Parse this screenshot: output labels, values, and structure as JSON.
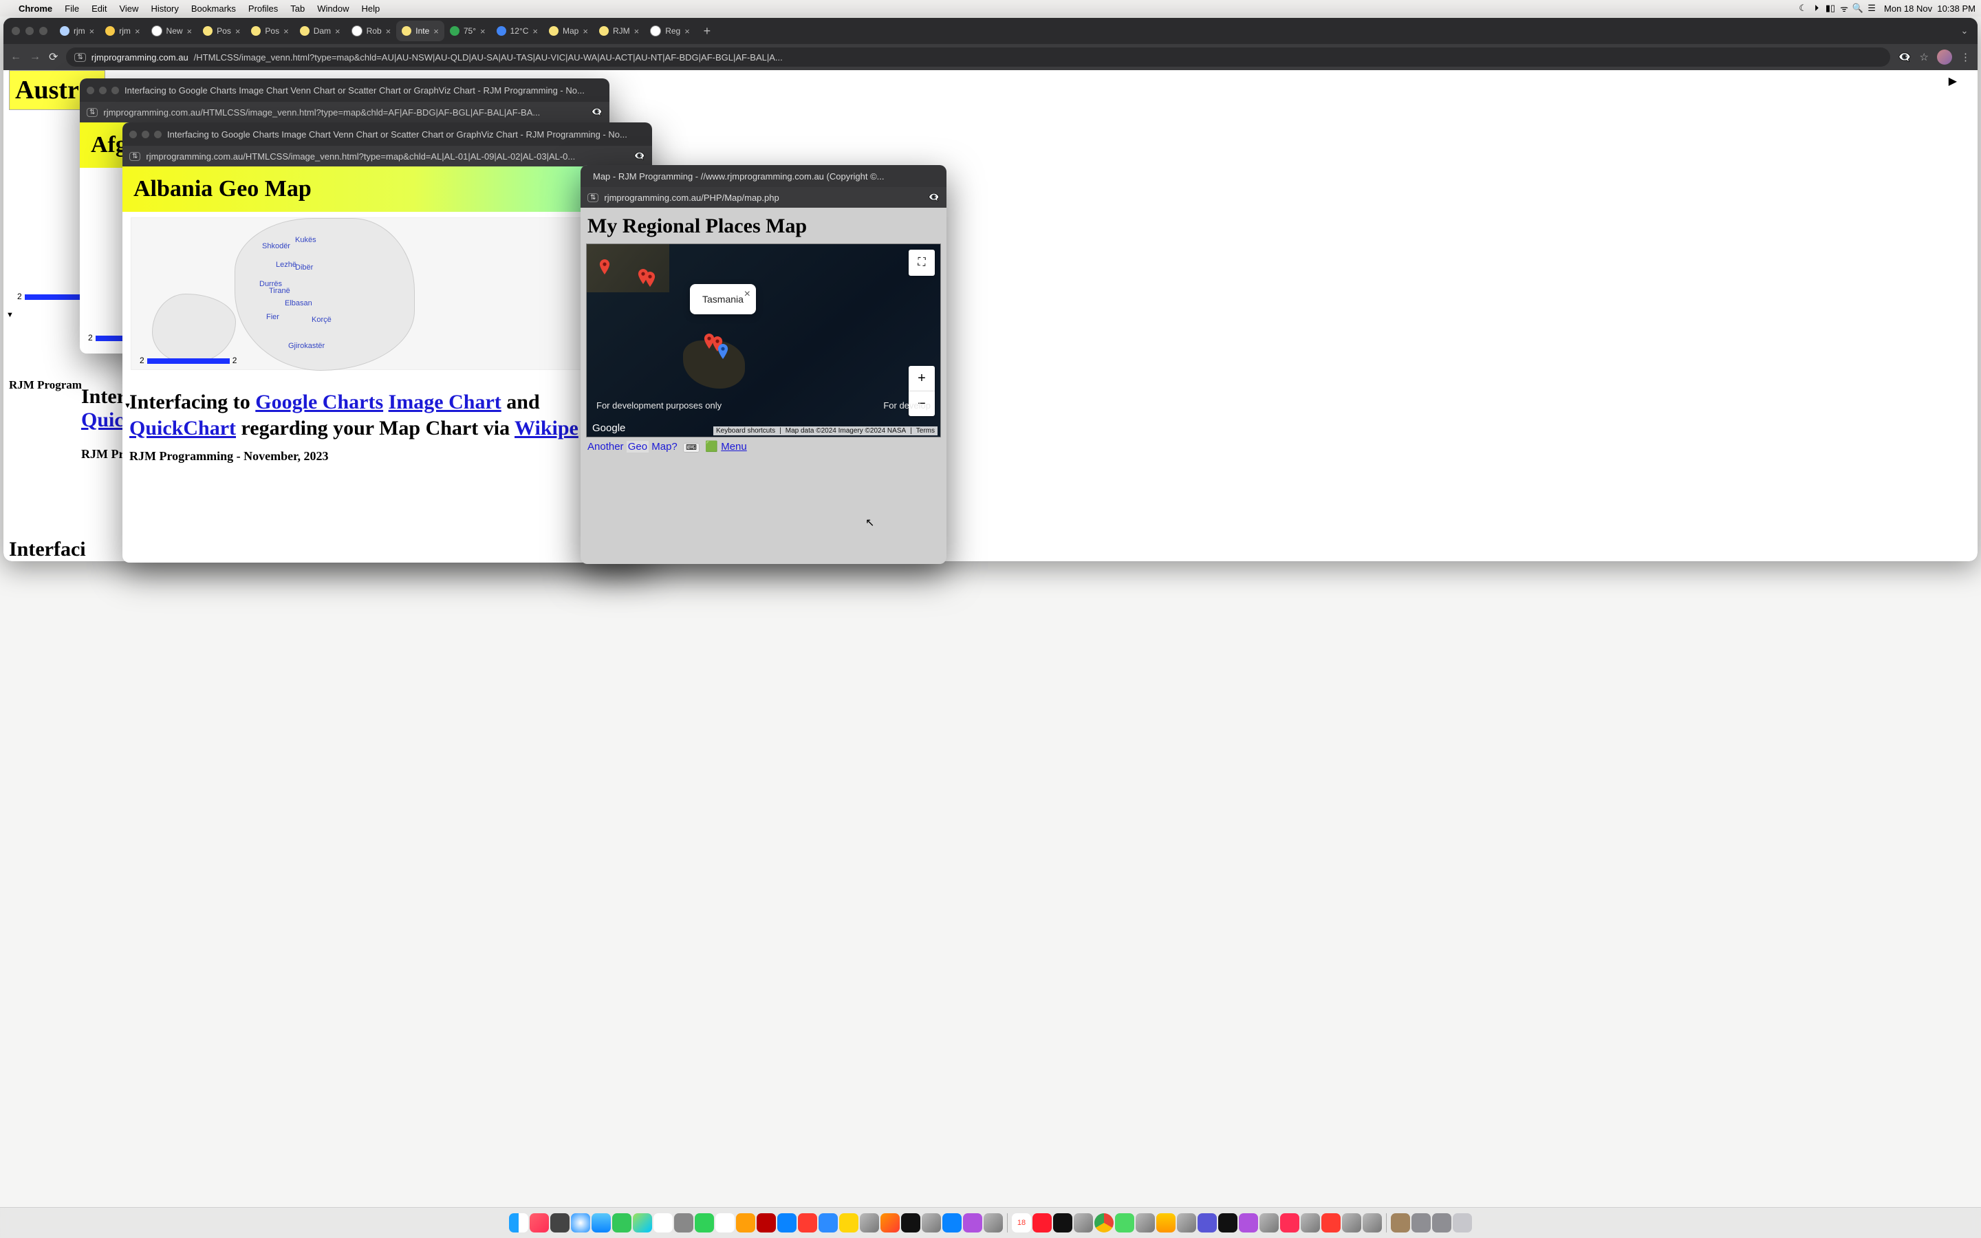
{
  "menubar": {
    "app": "Chrome",
    "items": [
      "File",
      "Edit",
      "View",
      "History",
      "Bookmarks",
      "Profiles",
      "Tab",
      "Window",
      "Help"
    ],
    "date": "Mon 18 Nov",
    "time": "10:38 PM"
  },
  "browser": {
    "tabs": [
      {
        "label": "rjm",
        "favColor": "#b2d2ff",
        "active": false
      },
      {
        "label": "rjm",
        "favColor": "#f7c948",
        "active": false
      },
      {
        "label": "New",
        "favColor": "#ffffff",
        "active": false
      },
      {
        "label": "Pos",
        "favColor": "#f8e27b",
        "active": false
      },
      {
        "label": "Pos",
        "favColor": "#f8e27b",
        "active": false
      },
      {
        "label": "Dam",
        "favColor": "#f8e27b",
        "active": false
      },
      {
        "label": "Rob",
        "favColor": "#ffffff",
        "active": false
      },
      {
        "label": "Inte",
        "favColor": "#f8e27b",
        "active": true
      },
      {
        "label": "75°",
        "favColor": "#34a853",
        "active": false
      },
      {
        "label": "12°C",
        "favColor": "#4285f4",
        "active": false
      },
      {
        "label": "Map",
        "favColor": "#f8e27b",
        "active": false
      },
      {
        "label": "RJM",
        "favColor": "#f8e27b",
        "active": false
      },
      {
        "label": "Reg",
        "favColor": "#ffffff",
        "active": false
      }
    ],
    "url_domain": "rjmprogramming.com.au",
    "url_path": "/HTMLCSS/image_venn.html?type=map&chld=AU|AU-NSW|AU-QLD|AU-SA|AU-TAS|AU-VIC|AU-WA|AU-ACT|AU-NT|AF-BDG|AF-BGL|AF-BAL|A..."
  },
  "page_bg": {
    "title": "Austral",
    "heading_pre": "Interfaci",
    "byline": "RJM Program",
    "scale_a": "2",
    "heading2_l1": "Inter",
    "heading2_l2": "Quic",
    "byline2": "RJM Pr"
  },
  "pop1": {
    "wtitle": "Interfacing to Google Charts Image Chart Venn Chart or Scatter Chart or GraphViz Chart - RJM Programming - No...",
    "url": "rjmprogramming.com.au/HTMLCSS/image_venn.html?type=map&chld=AF|AF-BDG|AF-BGL|AF-BAL|AF-BA...",
    "title": "Afg",
    "scale_a": "2"
  },
  "pop2": {
    "wtitle": "Interfacing to Google Charts Image Chart Venn Chart or Scatter Chart or GraphViz Chart - RJM Programming - No...",
    "url": "rjmprogramming.com.au/HTMLCSS/image_venn.html?type=map&chld=AL|AL-01|AL-09|AL-02|AL-03|AL-0...",
    "title": "Albania Geo Map",
    "cities": [
      "Shkodër",
      "Kukës",
      "Lezhë",
      "Dibër",
      "Durrës",
      "Tiranë",
      "Elbasan",
      "Fier",
      "Korçë",
      "Gjirokastër"
    ],
    "scale_a": "2",
    "scale_b": "2",
    "headline_pre": "Interfacing to ",
    "link1": "Google Charts",
    "link2": "Image Chart",
    "mid": " and ",
    "link3": "QuickChart",
    "tail": " regarding your Map Chart via ",
    "link4": "Wikipe",
    "byline": "RJM Programming - November, 2023"
  },
  "mapwin": {
    "wtitle": "Map - RJM Programming - //www.rjmprogramming.com.au (Copyright ©...",
    "url": "rjmprogramming.com.au/PHP/Map/map.php",
    "h1": "My Regional Places Map",
    "info_label": "Tasmania",
    "dev_only": "For development purposes only",
    "dev_only_r": "For develop",
    "google": "Google",
    "kb": "Keyboard shortcuts",
    "mapdata": "Map data ©2024 Imagery ©2024 NASA",
    "terms": "Terms",
    "link_pre": "Another ",
    "link_mid": "Geo",
    "link_post": " Map?",
    "kb_icon": "⌨︎",
    "menu_icon": "🟩",
    "menu": "Menu"
  },
  "chart_data": {
    "type": "map",
    "title": "Albania Geo Map",
    "regions": [
      {
        "name": "Shkodër"
      },
      {
        "name": "Kukës"
      },
      {
        "name": "Lezhë"
      },
      {
        "name": "Dibër"
      },
      {
        "name": "Durrës"
      },
      {
        "name": "Tiranë"
      },
      {
        "name": "Elbasan"
      },
      {
        "name": "Fier"
      },
      {
        "name": "Korçë"
      },
      {
        "name": "Gjirokastër"
      }
    ],
    "scale_values": [
      2,
      2
    ]
  }
}
